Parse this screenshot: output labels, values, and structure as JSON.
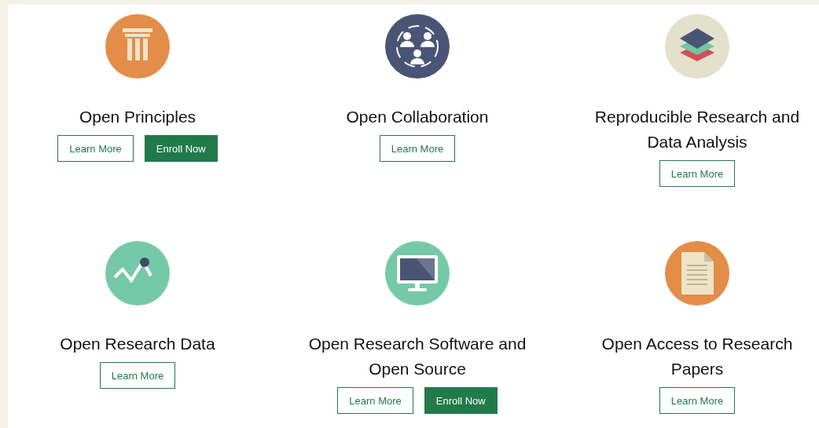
{
  "courses": [
    {
      "title": "Open Principles",
      "kind": "pillar",
      "buttons": [
        {
          "label": "Learn More",
          "kind": "outline"
        },
        {
          "label": "Enroll Now",
          "kind": "filled"
        }
      ]
    },
    {
      "title": "Open Collaboration",
      "kind": "people",
      "buttons": [
        {
          "label": "Learn More",
          "kind": "outline"
        }
      ]
    },
    {
      "title": "Reproducible Research and Data Analysis",
      "kind": "layers",
      "buttons": [
        {
          "label": "Learn More",
          "kind": "outline"
        }
      ]
    },
    {
      "title": "Open Research Data",
      "kind": "chart",
      "buttons": [
        {
          "label": "Learn More",
          "kind": "outline"
        }
      ]
    },
    {
      "title": "Open Research Software and Open Source",
      "kind": "monitor",
      "buttons": [
        {
          "label": "Learn More",
          "kind": "outline"
        },
        {
          "label": "Enroll Now",
          "kind": "filled"
        }
      ]
    },
    {
      "title": "Open Access to Research Papers",
      "kind": "document",
      "buttons": [
        {
          "label": "Learn More",
          "kind": "outline"
        }
      ]
    }
  ]
}
